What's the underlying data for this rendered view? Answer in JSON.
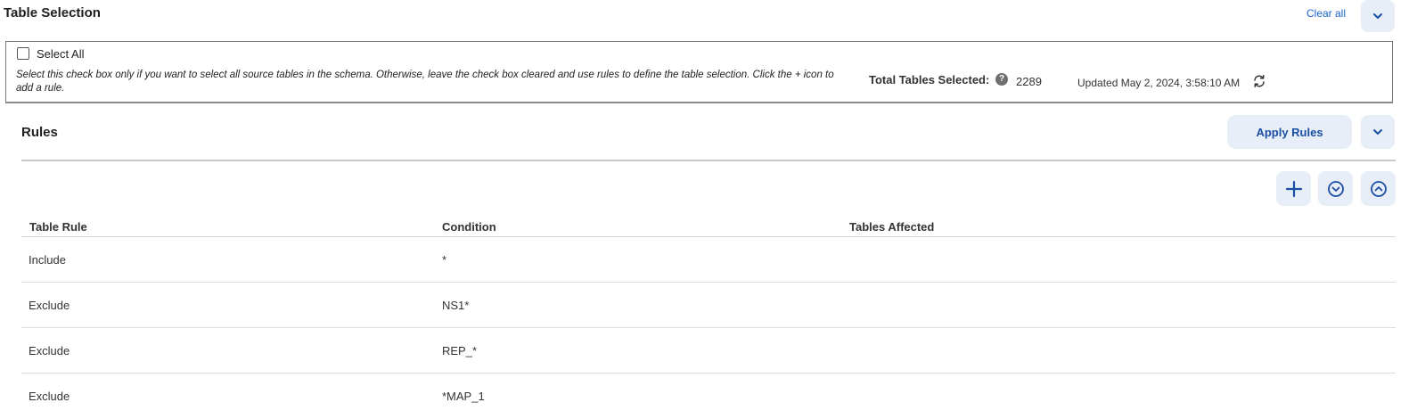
{
  "header": {
    "title": "Table Selection",
    "clear_all_label": "Clear all"
  },
  "select_all": {
    "label": "Select All",
    "checked": false,
    "helper_text": "Select this check box only if you want to select all source tables in the schema. Otherwise, leave the check box cleared and use rules to define the table selection. Click the + icon to add a rule.",
    "total_label": "Total Tables Selected:",
    "help_glyph": "?",
    "total_value": "2289",
    "updated_text": "Updated May 2, 2024, 3:58:10 AM"
  },
  "rules": {
    "title": "Rules",
    "apply_label": "Apply Rules",
    "columns": [
      "Table Rule",
      "Condition",
      "Tables Affected"
    ],
    "rows": [
      {
        "rule": "Include",
        "condition": "*",
        "affected": ""
      },
      {
        "rule": "Exclude",
        "condition": "NS1*",
        "affected": ""
      },
      {
        "rule": "Exclude",
        "condition": "REP_*",
        "affected": ""
      },
      {
        "rule": "Exclude",
        "condition": "*MAP_1",
        "affected": ""
      }
    ]
  },
  "icons": {
    "collapse_section": "chevron-down-icon",
    "collapse_rules": "chevron-down-icon",
    "add_rule": "plus-icon",
    "expand_all": "circle-chevron-down-icon",
    "collapse_all": "circle-chevron-up-icon",
    "refresh": "refresh-icon",
    "help": "help-icon"
  },
  "colors": {
    "accent": "#1a63c8",
    "button_bg": "#e8eef7",
    "button_text": "#1a4fa3"
  }
}
